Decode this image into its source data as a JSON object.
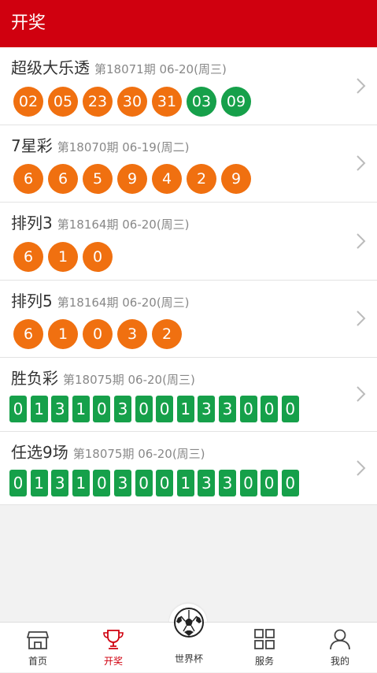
{
  "header": {
    "title": "开奖"
  },
  "draws": [
    {
      "name": "超级大乐透",
      "issue": "第18071期",
      "date": "06-20(周三)",
      "balls": [
        {
          "n": "02",
          "c": "red"
        },
        {
          "n": "05",
          "c": "red"
        },
        {
          "n": "23",
          "c": "red"
        },
        {
          "n": "30",
          "c": "red"
        },
        {
          "n": "31",
          "c": "red"
        },
        {
          "n": "03",
          "c": "green"
        },
        {
          "n": "09",
          "c": "green"
        }
      ]
    },
    {
      "name": "7星彩",
      "issue": "第18070期",
      "date": "06-19(周二)",
      "balls": [
        {
          "n": "6",
          "c": "red"
        },
        {
          "n": "6",
          "c": "red"
        },
        {
          "n": "5",
          "c": "red"
        },
        {
          "n": "9",
          "c": "red"
        },
        {
          "n": "4",
          "c": "red"
        },
        {
          "n": "2",
          "c": "red"
        },
        {
          "n": "9",
          "c": "red"
        }
      ]
    },
    {
      "name": "排列3",
      "issue": "第18164期",
      "date": "06-20(周三)",
      "balls": [
        {
          "n": "6",
          "c": "red"
        },
        {
          "n": "1",
          "c": "red"
        },
        {
          "n": "0",
          "c": "red"
        }
      ]
    },
    {
      "name": "排列5",
      "issue": "第18164期",
      "date": "06-20(周三)",
      "balls": [
        {
          "n": "6",
          "c": "red"
        },
        {
          "n": "1",
          "c": "red"
        },
        {
          "n": "0",
          "c": "red"
        },
        {
          "n": "3",
          "c": "red"
        },
        {
          "n": "2",
          "c": "red"
        }
      ]
    },
    {
      "name": "胜负彩",
      "issue": "第18075期",
      "date": "06-20(周三)",
      "digits": [
        "0",
        "1",
        "3",
        "1",
        "0",
        "3",
        "0",
        "0",
        "1",
        "3",
        "3",
        "0",
        "0",
        "0"
      ]
    },
    {
      "name": "任选9场",
      "issue": "第18075期",
      "date": "06-20(周三)",
      "digits": [
        "0",
        "1",
        "3",
        "1",
        "0",
        "3",
        "0",
        "0",
        "1",
        "3",
        "3",
        "0",
        "0",
        "0"
      ]
    }
  ],
  "tabs": [
    {
      "label": "首页",
      "icon": "store-icon"
    },
    {
      "label": "开奖",
      "icon": "trophy-icon"
    },
    {
      "label": "世界杯",
      "icon": "soccer-ball-icon"
    },
    {
      "label": "服务",
      "icon": "grid-icon"
    },
    {
      "label": "我的",
      "icon": "user-icon"
    }
  ],
  "active_tab": "开奖",
  "colors": {
    "header": "#d0000f",
    "red_ball": "#f07010",
    "green_ball": "#16a04a"
  }
}
